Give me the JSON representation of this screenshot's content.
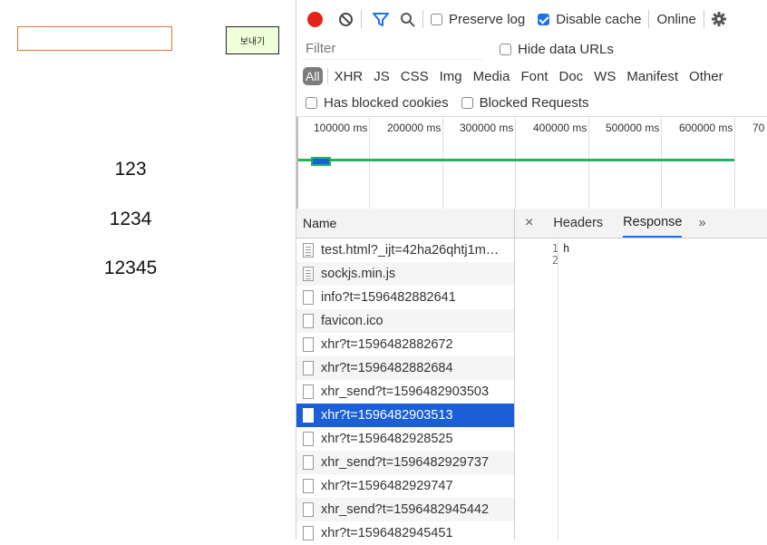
{
  "page": {
    "input_value": "",
    "send_label": "보내기",
    "messages": [
      "123",
      "1234",
      "12345"
    ]
  },
  "devtools": {
    "toolbar": {
      "preserve_log": "Preserve log",
      "preserve_log_checked": false,
      "disable_cache": "Disable cache",
      "disable_cache_checked": true,
      "throttling": "Online"
    },
    "filter": {
      "placeholder": "Filter",
      "hide_data_urls": "Hide data URLs"
    },
    "types": [
      "All",
      "XHR",
      "JS",
      "CSS",
      "Img",
      "Media",
      "Font",
      "Doc",
      "WS",
      "Manifest",
      "Other"
    ],
    "has_blocked_cookies": "Has blocked cookies",
    "blocked_requests": "Blocked Requests",
    "timeline_ticks": [
      "100000 ms",
      "200000 ms",
      "300000 ms",
      "400000 ms",
      "500000 ms",
      "600000 ms",
      "70"
    ],
    "name_header": "Name",
    "requests": [
      "test.html?_ijt=42ha26qhtj1m…",
      "sockjs.min.js",
      "info?t=1596482882641",
      "favicon.ico",
      "xhr?t=1596482882672",
      "xhr?t=1596482882684",
      "xhr_send?t=1596482903503",
      "xhr?t=1596482903513",
      "xhr?t=1596482928525",
      "xhr_send?t=1596482929737",
      "xhr?t=1596482929747",
      "xhr_send?t=1596482945442",
      "xhr?t=1596482945451"
    ],
    "selected_request": "xhr?t=1596482903513",
    "detail": {
      "close": "×",
      "tabs": [
        "Headers",
        "Response"
      ],
      "active_tab": "Response",
      "more": "»",
      "line_numbers": [
        "1",
        "2"
      ],
      "response_lines": [
        "h",
        ""
      ]
    },
    "colors": {
      "accent": "#1a73e8",
      "record": "#e2241b",
      "selected_row": "#1a5fd7",
      "timeline_green": "#21b35f"
    }
  }
}
